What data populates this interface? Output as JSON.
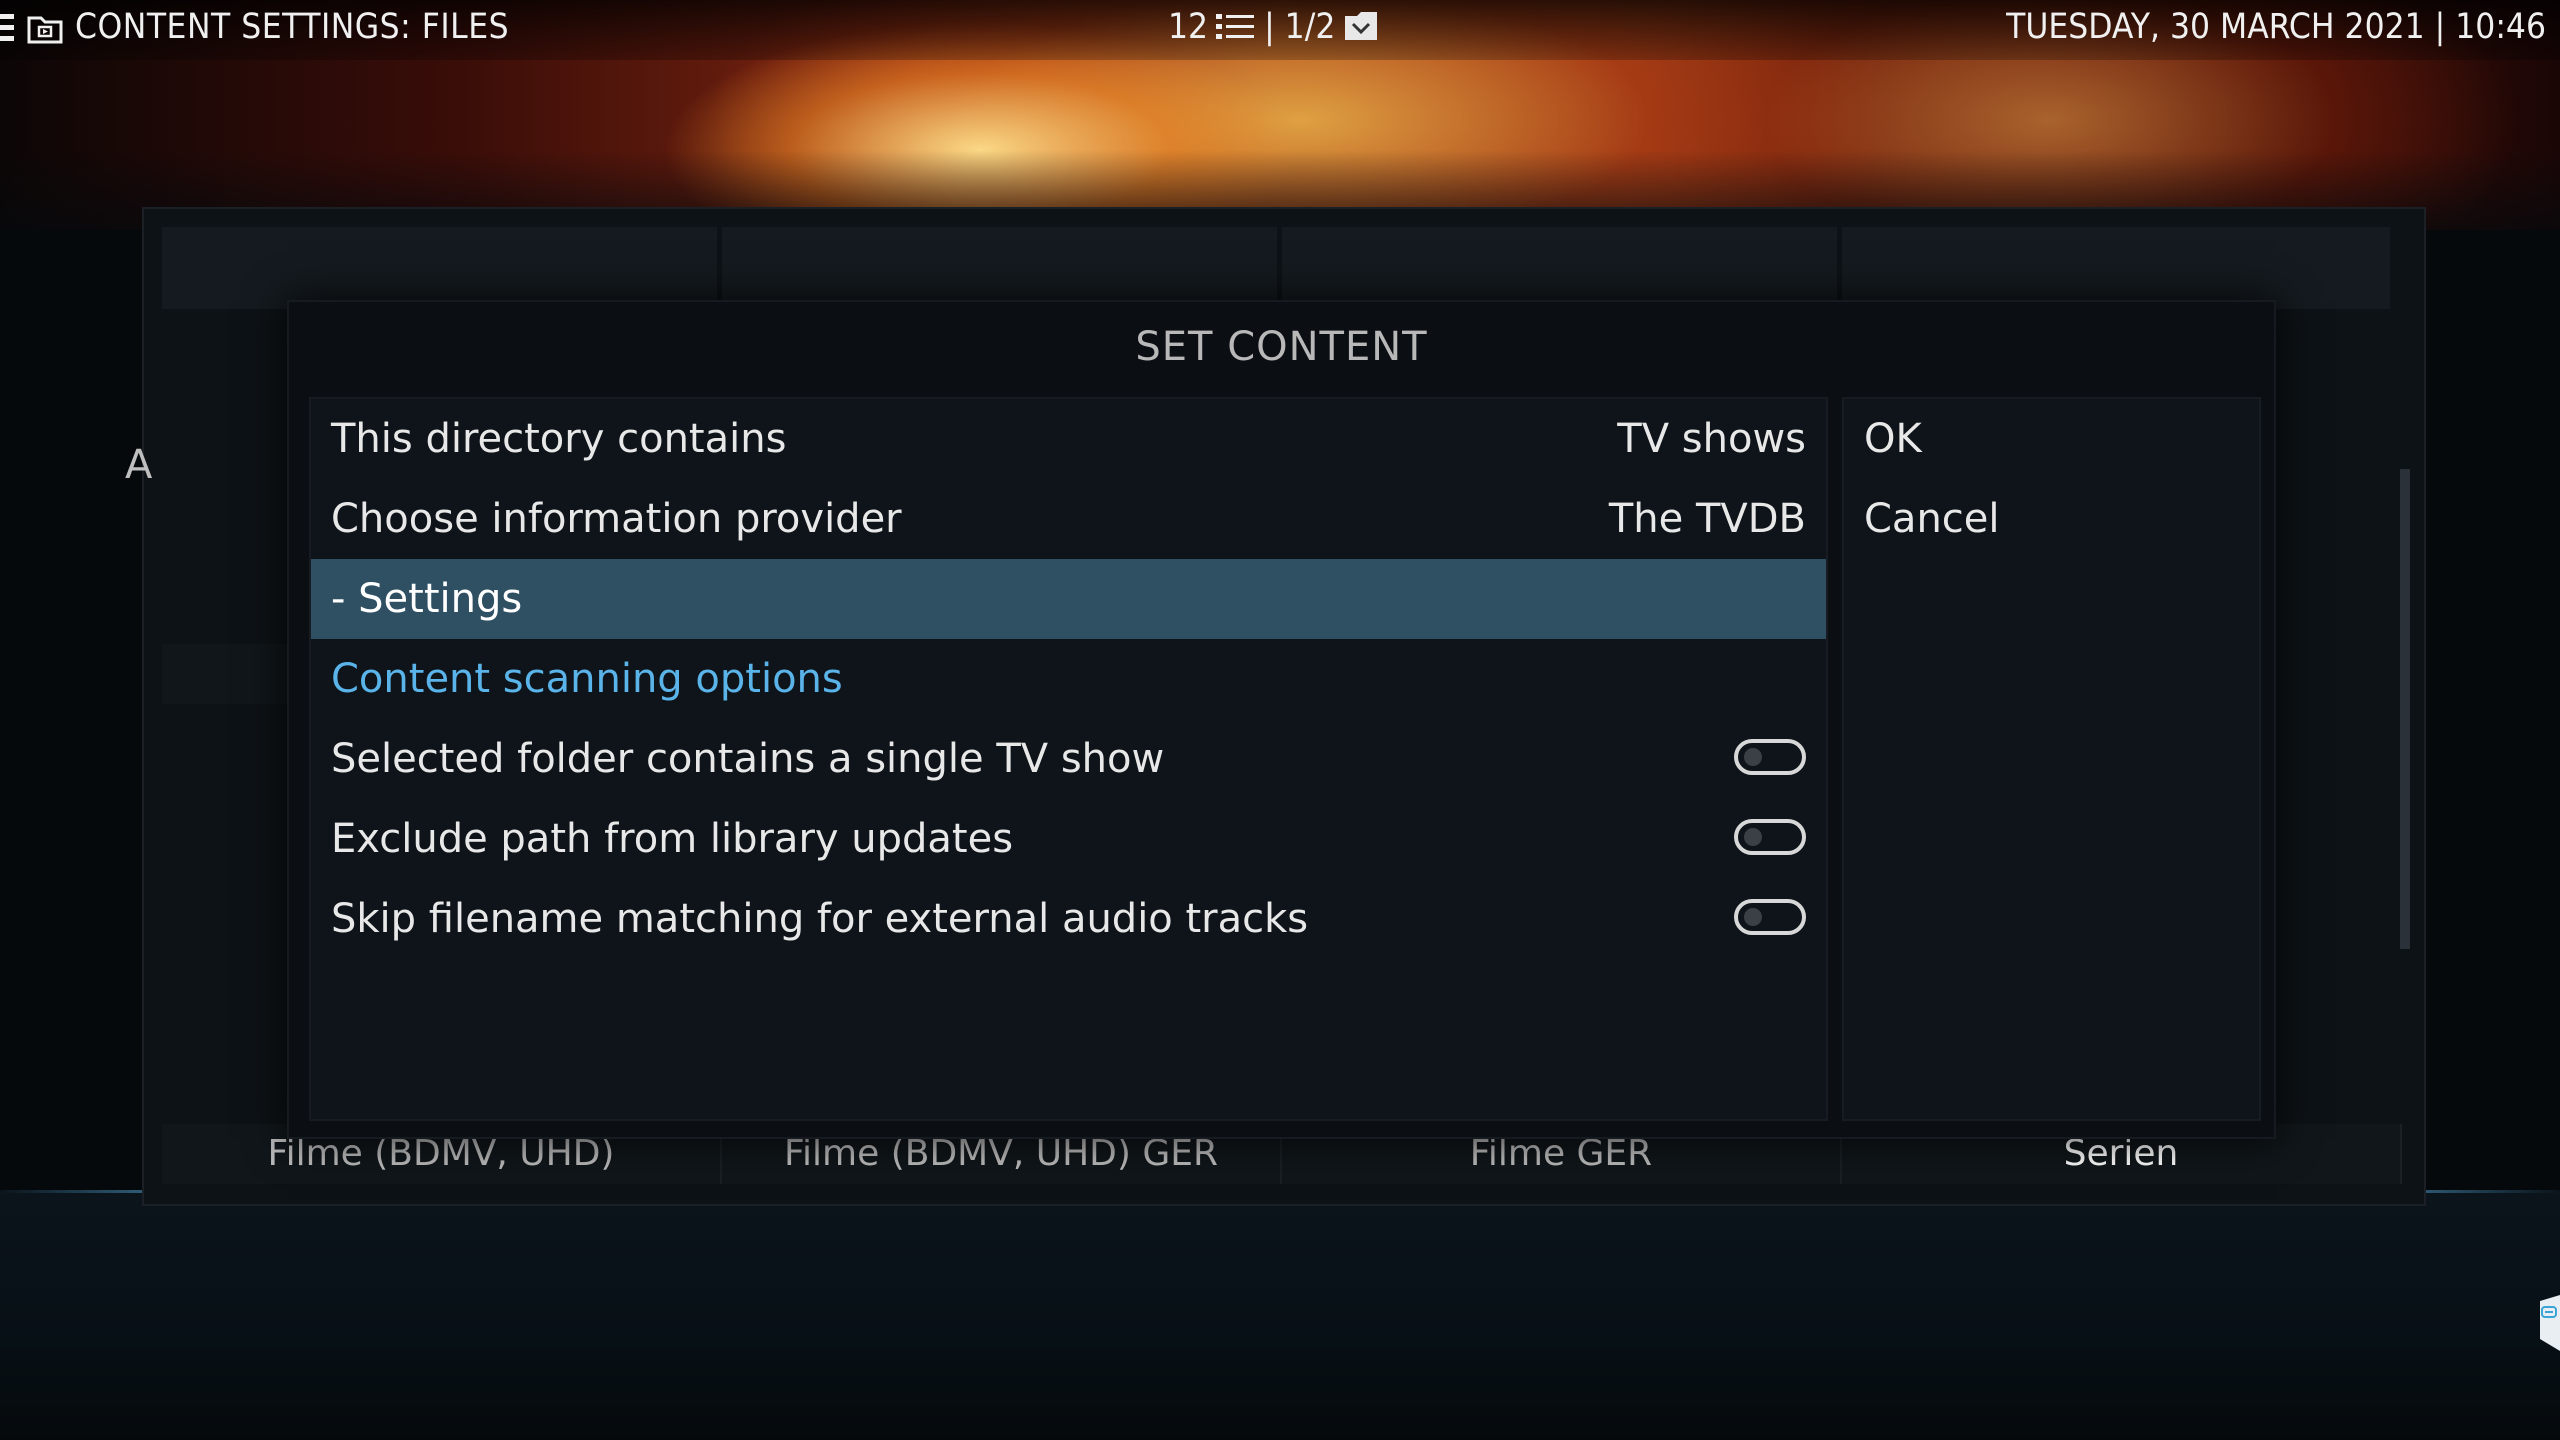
{
  "topbar": {
    "title": "CONTENT SETTINGS: FILES",
    "item_count": "12",
    "page": "| 1/2",
    "datetime": "TUESDAY, 30 MARCH 2021 | 10:46"
  },
  "background": {
    "stub_letter": "A",
    "tabs": [
      "Filme (BDMV, UHD)",
      "Filme (BDMV, UHD) GER",
      "Filme GER",
      "Serien"
    ]
  },
  "dialog": {
    "title": "SET CONTENT",
    "rows": {
      "directory": {
        "label": "This directory contains",
        "value": "TV shows"
      },
      "provider": {
        "label": "Choose information provider",
        "value": "The TVDB"
      },
      "settings": {
        "label": "- Settings"
      },
      "section": {
        "label": "Content scanning options"
      },
      "single_show": {
        "label": "Selected folder contains a single TV show",
        "enabled": false
      },
      "exclude_path": {
        "label": "Exclude path from library updates",
        "enabled": false
      },
      "skip_filename": {
        "label": "Skip filename matching for external audio tracks",
        "enabled": false
      }
    },
    "buttons": {
      "ok": "OK",
      "cancel": "Cancel"
    }
  },
  "colors": {
    "accent": "#3aa4d8",
    "selected_row": "#2f5063",
    "section_text": "#5ab4ea"
  },
  "icons": [
    "menu-icon",
    "folder-icon",
    "list-icon",
    "folder-icon",
    "side-gadget-icon"
  ]
}
